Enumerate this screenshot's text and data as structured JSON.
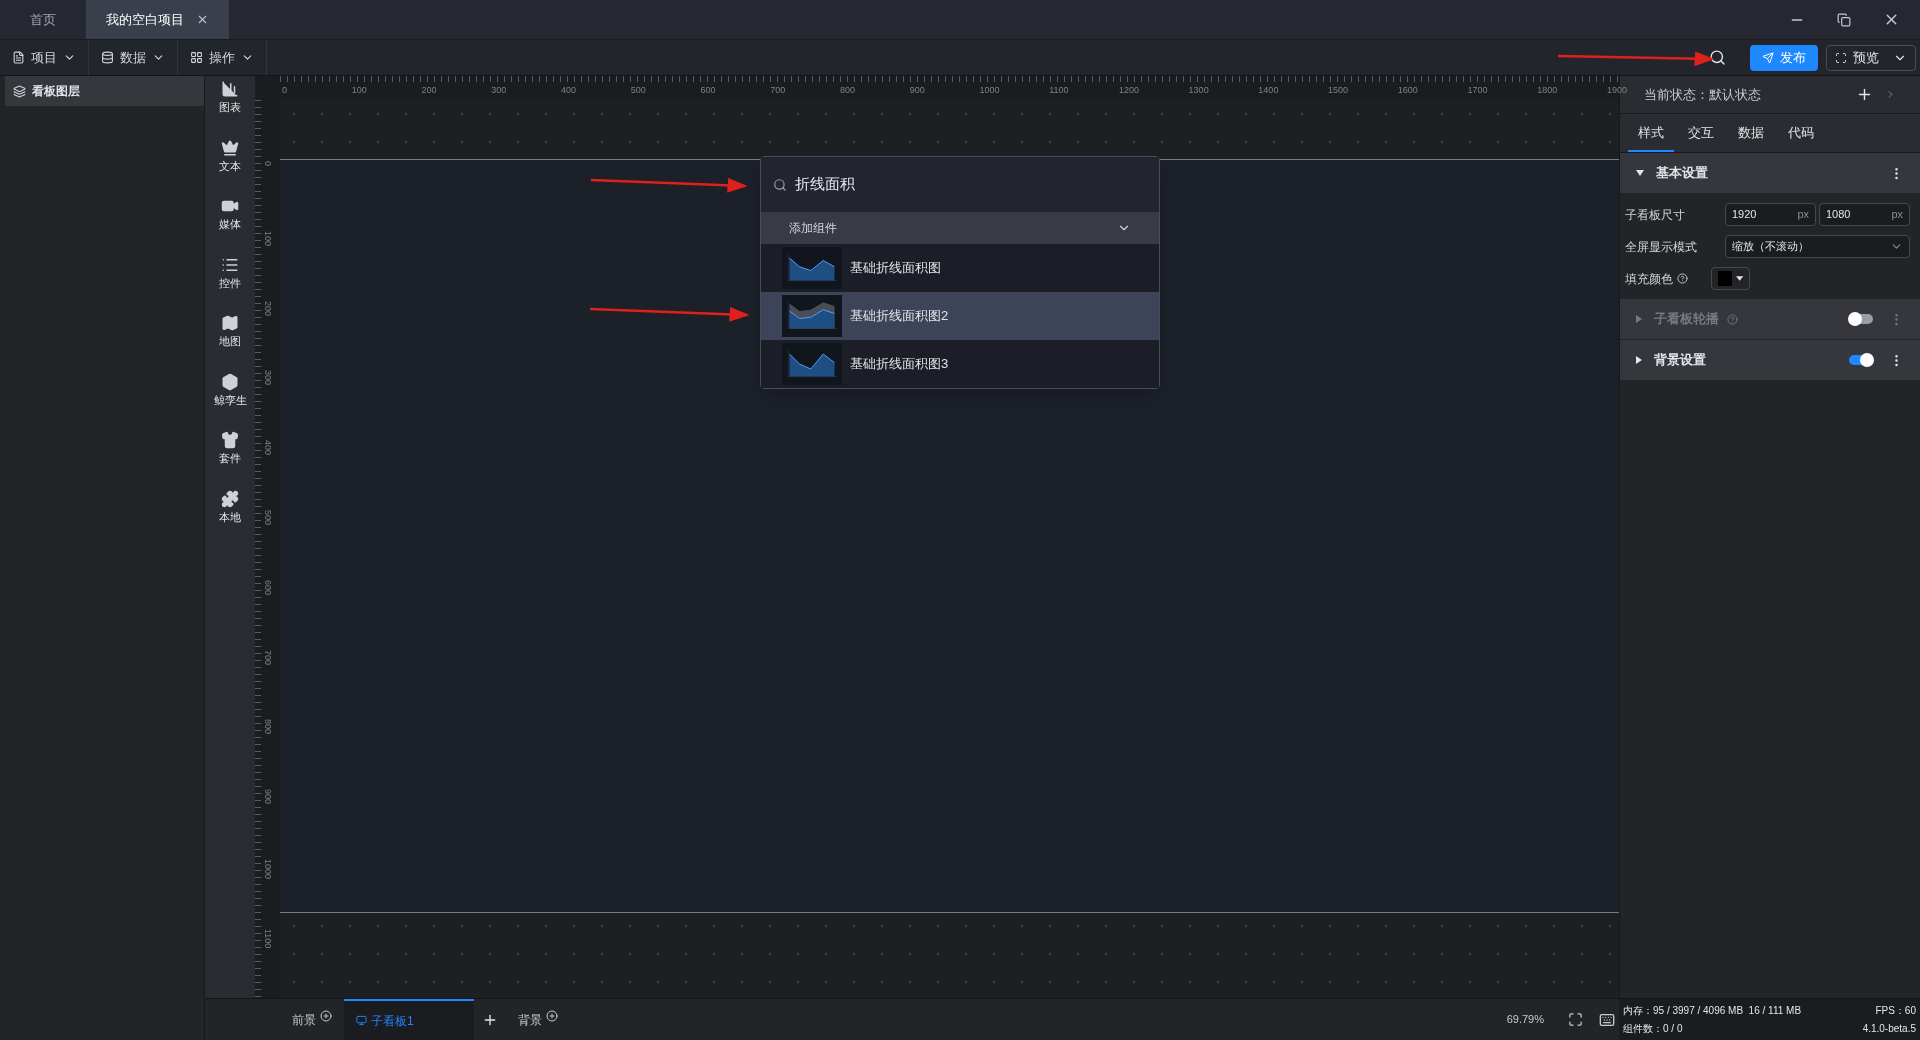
{
  "tabs": [
    {
      "label": "首页",
      "selected": false,
      "closable": false
    },
    {
      "label": "我的空白项目",
      "selected": true,
      "closable": true
    }
  ],
  "menu": [
    {
      "label": "项目",
      "kind": "file"
    },
    {
      "label": "数据",
      "kind": "database"
    },
    {
      "label": "操作",
      "kind": "grid"
    }
  ],
  "actions": {
    "publish": "发布",
    "preview": "预览"
  },
  "layers_panel": {
    "title": "看板图层"
  },
  "categories": [
    {
      "label": "图表",
      "kind": "chart"
    },
    {
      "label": "文本",
      "kind": "text"
    },
    {
      "label": "媒体",
      "kind": "media"
    },
    {
      "label": "控件",
      "kind": "control"
    },
    {
      "label": "地图",
      "kind": "map"
    },
    {
      "label": "鲸孪生",
      "kind": "twin"
    },
    {
      "label": "套件",
      "kind": "kit"
    },
    {
      "label": "本地",
      "kind": "local"
    }
  ],
  "ruler": {
    "x_labels": [
      "0",
      "100",
      "200",
      "300",
      "400",
      "500",
      "600",
      "700",
      "800",
      "900",
      "1000",
      "1100",
      "1200",
      "1300",
      "1400",
      "1500",
      "1600",
      "1700",
      "1800",
      "1900"
    ],
    "y_labels": [
      "0",
      "100",
      "200",
      "300",
      "400",
      "500",
      "600",
      "700",
      "800",
      "900",
      "1000",
      "1100"
    ]
  },
  "search_popup": {
    "query": "折线面积",
    "group": {
      "label": "添加组件",
      "expanded": true
    },
    "results": [
      {
        "label": "基础折线面积图",
        "selected": false
      },
      {
        "label": "基础折线面积图2",
        "selected": true
      },
      {
        "label": "基础折线面积图3",
        "selected": false
      }
    ]
  },
  "properties": {
    "state": "当前状态：默认状态",
    "tabs": [
      {
        "label": "样式",
        "selected": true
      },
      {
        "label": "交互",
        "selected": false
      },
      {
        "label": "数据",
        "selected": false
      },
      {
        "label": "代码",
        "selected": false
      }
    ],
    "sections": [
      {
        "title": "基本设置",
        "expanded": true,
        "disabled": false,
        "help": false,
        "kind": "plain"
      },
      {
        "title": "子看板轮播",
        "expanded": false,
        "disabled": true,
        "help": true,
        "kind": "toggle",
        "on": false
      },
      {
        "title": "背景设置",
        "expanded": false,
        "disabled": false,
        "help": false,
        "kind": "toggle",
        "on": true
      }
    ],
    "size": {
      "label": "子看板尺寸",
      "inputs": [
        {
          "value": "1920",
          "unit": "px"
        },
        {
          "value": "1080",
          "unit": "px"
        }
      ]
    },
    "mode": {
      "label": "全屏显示模式",
      "value": "缩放（不滚动）"
    },
    "fill": {
      "label": "填充颜色",
      "color": "#000000"
    }
  },
  "pages": [
    {
      "label": "前景",
      "selected": false,
      "kind": "layer"
    },
    {
      "label": "子看板1",
      "selected": true,
      "kind": "board"
    },
    {
      "label": "背景",
      "selected": false,
      "kind": "layer"
    }
  ],
  "zoom": "69.79%",
  "status": {
    "memory": "内存：95 / 3997 / 4096 MB  16 / 111 MB",
    "fps": "FPS：60",
    "count": "组件数：0 / 0",
    "version": "4.1.0-beta.5"
  }
}
